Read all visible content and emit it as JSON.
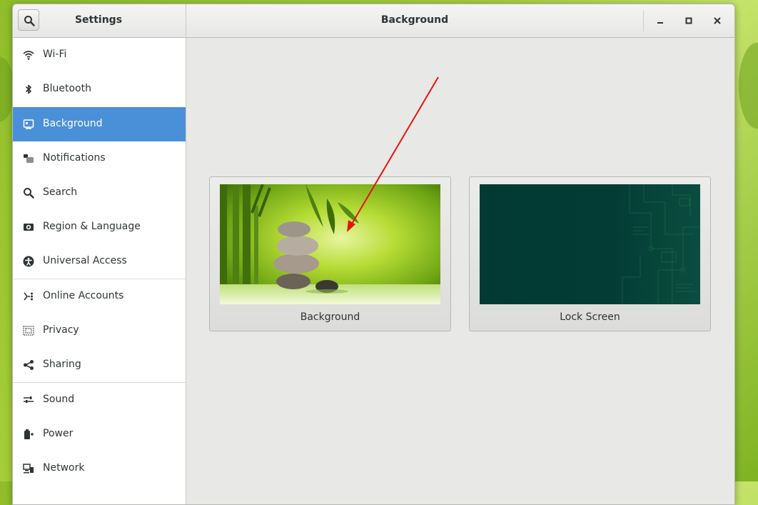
{
  "window": {
    "sidebar_title": "Settings",
    "main_title": "Background"
  },
  "sidebar": {
    "items": [
      {
        "label": "Wi-Fi",
        "icon": "wifi-icon"
      },
      {
        "label": "Bluetooth",
        "icon": "bluetooth-icon"
      },
      {
        "label": "Background",
        "icon": "background-icon",
        "selected": true
      },
      {
        "label": "Notifications",
        "icon": "notifications-icon"
      },
      {
        "label": "Search",
        "icon": "search-icon"
      },
      {
        "label": "Region & Language",
        "icon": "region-icon"
      },
      {
        "label": "Universal Access",
        "icon": "universal-access-icon"
      },
      {
        "label": "Online Accounts",
        "icon": "online-accounts-icon"
      },
      {
        "label": "Privacy",
        "icon": "privacy-icon"
      },
      {
        "label": "Sharing",
        "icon": "sharing-icon"
      },
      {
        "label": "Sound",
        "icon": "sound-icon"
      },
      {
        "label": "Power",
        "icon": "power-icon"
      },
      {
        "label": "Network",
        "icon": "network-icon"
      }
    ]
  },
  "main": {
    "cards": [
      {
        "label": "Background"
      },
      {
        "label": "Lock Screen"
      }
    ]
  },
  "colors": {
    "selection": "#4a90d9",
    "annotation_arrow": "#e8120c"
  }
}
